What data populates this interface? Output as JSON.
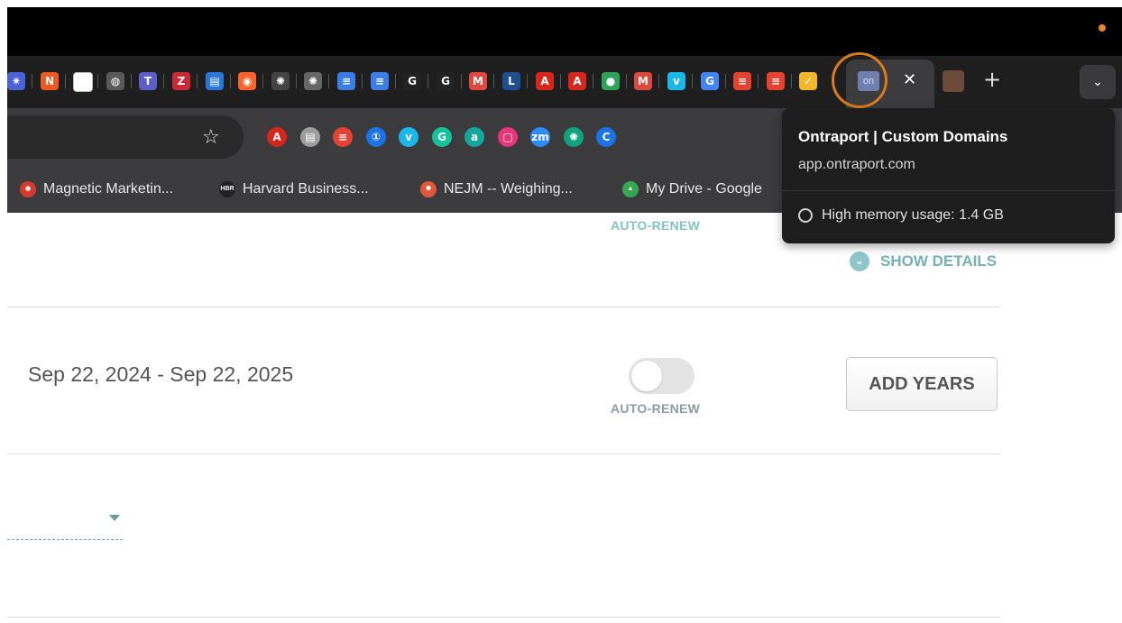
{
  "browser": {
    "tab_icons": [
      {
        "name": "asterisk-tab-icon",
        "glyph": "✷",
        "color": "#4a63d8"
      },
      {
        "name": "orange-n-tab-icon",
        "glyph": "N",
        "color": "#f05a22"
      },
      {
        "name": "white-doc-tab-icon",
        "glyph": "",
        "color": "#ffffff"
      },
      {
        "name": "globe-tab-icon",
        "glyph": "◍",
        "color": "#5a5a5a"
      },
      {
        "name": "teams-tab-icon",
        "glyph": "T",
        "color": "#5b5fc7"
      },
      {
        "name": "zotero-tab-icon",
        "glyph": "Z",
        "color": "#cc2936"
      },
      {
        "name": "slides-tab-icon",
        "glyph": "▤",
        "color": "#2b77d9"
      },
      {
        "name": "semrush-tab-icon",
        "glyph": "◉",
        "color": "#ff642d"
      },
      {
        "name": "chatgpt-tab-icon",
        "glyph": "✺",
        "color": "#444444"
      },
      {
        "name": "chatgpt-alt-tab-icon",
        "glyph": "✺",
        "color": "#666666"
      },
      {
        "name": "docs-tab-icon",
        "glyph": "≡",
        "color": "#3b7ee8"
      },
      {
        "name": "docs-alt-tab-icon",
        "glyph": "≡",
        "color": "#3b7ee8"
      },
      {
        "name": "g-yellow-tab-icon",
        "glyph": "G",
        "color": "#232323"
      },
      {
        "name": "g-white-tab-icon",
        "glyph": "G",
        "color": "#232323"
      },
      {
        "name": "gmail-tab-icon",
        "glyph": "M",
        "color": "#e0483e"
      },
      {
        "name": "linkedin-tab-icon",
        "glyph": "L",
        "color": "#1f4f8f"
      },
      {
        "name": "acrobat-tab-icon",
        "glyph": "A",
        "color": "#d8261c"
      },
      {
        "name": "acrobat-alt-tab-icon",
        "glyph": "A",
        "color": "#d8261c"
      },
      {
        "name": "colorful-circle-tab-icon",
        "glyph": "●",
        "color": "#2fa35a"
      },
      {
        "name": "gmail-alt-tab-icon",
        "glyph": "M",
        "color": "#e0483e"
      },
      {
        "name": "vimeo-tab-icon",
        "glyph": "v",
        "color": "#1ab7ea"
      },
      {
        "name": "google-tab-icon",
        "glyph": "G",
        "color": "#4285f4"
      },
      {
        "name": "todoist-tab-icon",
        "glyph": "≡",
        "color": "#e44332"
      },
      {
        "name": "todoist-alt-tab-icon",
        "glyph": "≡",
        "color": "#e44332"
      },
      {
        "name": "checklist-tab-icon",
        "glyph": "✓",
        "color": "#f1b82d"
      }
    ],
    "active_tab_icon_label": "on",
    "close_glyph": "✕",
    "new_tab_glyph": "+",
    "tab_dropdown_glyph": "⌄",
    "bookmark_star_glyph": "☆",
    "extensions": [
      {
        "name": "acrobat-extension-icon",
        "glyph": "A",
        "color": "#d8261c"
      },
      {
        "name": "document-extension-icon",
        "glyph": "▤",
        "color": "#9e9e9e"
      },
      {
        "name": "todoist-extension-icon",
        "glyph": "≡",
        "color": "#e44332"
      },
      {
        "name": "1password-extension-icon",
        "glyph": "①",
        "color": "#1a73e8"
      },
      {
        "name": "vimeo-extension-icon",
        "glyph": "v",
        "color": "#1ab7ea"
      },
      {
        "name": "grammarly-extension-icon",
        "glyph": "G",
        "color": "#15c39a"
      },
      {
        "name": "a-extension-icon",
        "glyph": "a",
        "color": "#13a89e"
      },
      {
        "name": "pink-square-extension-icon",
        "glyph": "▢",
        "color": "#e6357b"
      },
      {
        "name": "zoom-extension-icon",
        "glyph": "zm",
        "color": "#2d8cff"
      },
      {
        "name": "chatgpt-extension-icon",
        "glyph": "✺",
        "color": "#10a37f"
      },
      {
        "name": "c-extension-icon",
        "glyph": "C",
        "color": "#1a73e8"
      }
    ],
    "bookmarks": [
      {
        "name": "bookmark-magnetic-marketing",
        "label": "Magnetic Marketin...",
        "color": "#d63b2f",
        "badge": "◉"
      },
      {
        "name": "bookmark-harvard-business",
        "label": "Harvard Business...",
        "color": "#222222",
        "badge": "HBR"
      },
      {
        "name": "bookmark-nejm",
        "label": "NEJM -- Weighing...",
        "color": "#e0583c",
        "badge": "✺"
      },
      {
        "name": "bookmark-my-drive",
        "label": "My Drive - Google",
        "color": "#34a853",
        "badge": "▲"
      }
    ],
    "tooltip": {
      "title": "Ontraport | Custom Domains",
      "url": "app.ontraport.com",
      "memory": "High memory usage: 1.4 GB"
    }
  },
  "page": {
    "autorenew_top": "AUTO-RENEW",
    "show_details": "SHOW DETAILS",
    "show_details_icon": "⌄",
    "date_range": "Sep 22, 2024 - Sep 22, 2025",
    "autorenew_label": "AUTO-RENEW",
    "add_years": "ADD YEARS"
  }
}
